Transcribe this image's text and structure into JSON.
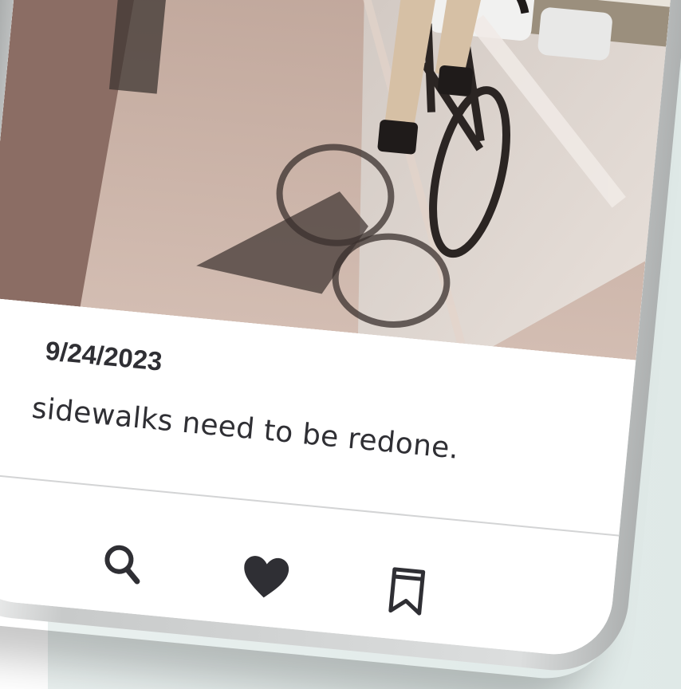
{
  "post": {
    "date": "9/24/2023",
    "text": "sidewalks need to be redone."
  },
  "photo": {
    "subject": "cyclist riding a bicycle along a city sidewalk"
  },
  "nav": {
    "items": [
      {
        "icon": "search-icon"
      },
      {
        "icon": "heart-icon"
      },
      {
        "icon": "bookmark-icon"
      }
    ]
  },
  "colors": {
    "text": "#2f2f34",
    "icon": "#2f2f34",
    "divider": "#d3d4d5",
    "background": "#e4ecea"
  }
}
